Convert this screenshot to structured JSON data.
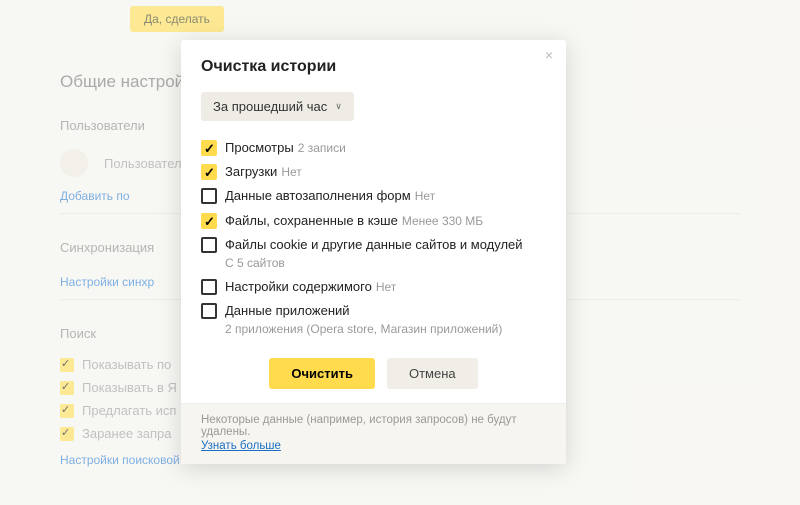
{
  "bg": {
    "top_button": "Да, сделать",
    "h1": "Общие настройки",
    "users_h": "Пользователи",
    "user_label": "Пользователь",
    "add_user": "Добавить по",
    "sync_h": "Синхронизация",
    "sync_link": "Настройки синхр",
    "search_h": "Поиск",
    "search_items": [
      "Показывать по",
      "Показывать в Я",
      "Предлагать исп",
      "Заранее запра"
    ],
    "search_settings": "Настройки поисковой системы"
  },
  "modal": {
    "title": "Очистка истории",
    "dropdown": "За прошедший час",
    "options": [
      {
        "checked": true,
        "label": "Просмотры",
        "hint": "2 записи"
      },
      {
        "checked": true,
        "label": "Загрузки",
        "hint": "Нет"
      },
      {
        "checked": false,
        "label": "Данные автозаполнения форм",
        "hint": "Нет"
      },
      {
        "checked": true,
        "label": "Файлы, сохраненные в кэше",
        "hint": "Менее 330 МБ"
      },
      {
        "checked": false,
        "label": "Файлы cookie и другие данные сайтов и модулей",
        "sub": "С 5 сайтов"
      },
      {
        "checked": false,
        "label": "Настройки содержимого",
        "hint": "Нет"
      },
      {
        "checked": false,
        "label": "Данные приложений",
        "sub": "2 приложения (Opera store, Магазин приложений)"
      }
    ],
    "primary": "Очистить",
    "secondary": "Отмена",
    "foot_text": "Некоторые данные (например, история запросов) не будут удалены.",
    "foot_link": "Узнать больше"
  }
}
